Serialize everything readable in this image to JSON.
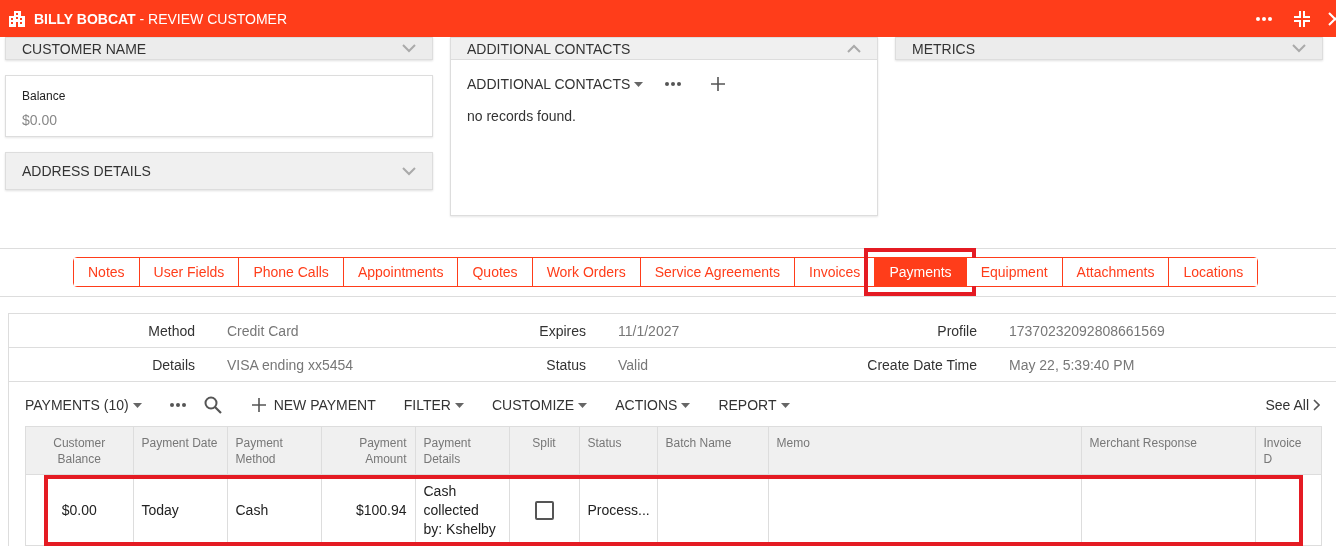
{
  "header": {
    "name": "BILLY BOBCAT",
    "title": "- REVIEW CUSTOMER"
  },
  "left_panels": [
    {
      "kind": "section",
      "title": "CUSTOMER NAME",
      "expanded": false
    },
    {
      "kind": "field",
      "label": "Balance",
      "value": "$0.00"
    },
    {
      "kind": "section",
      "title": "ADDRESS DETAILS",
      "expanded": false
    }
  ],
  "contacts": {
    "title": "ADDITIONAL CONTACTS",
    "expanded": true,
    "list_title": "ADDITIONAL CONTACTS",
    "empty_text": "no records found."
  },
  "metrics": {
    "title": "METRICS",
    "expanded": false
  },
  "tabs": [
    {
      "label": "Notes",
      "selected": false,
      "highlighted": false
    },
    {
      "label": "User Fields",
      "selected": false,
      "highlighted": false
    },
    {
      "label": "Phone Calls",
      "selected": false,
      "highlighted": false
    },
    {
      "label": "Appointments",
      "selected": false,
      "highlighted": false
    },
    {
      "label": "Quotes",
      "selected": false,
      "highlighted": false
    },
    {
      "label": "Work Orders",
      "selected": false,
      "highlighted": false
    },
    {
      "label": "Service Agreements",
      "selected": false,
      "highlighted": false
    },
    {
      "label": "Invoices",
      "selected": false,
      "highlighted": false
    },
    {
      "label": "Payments",
      "selected": true,
      "highlighted": true
    },
    {
      "label": "Equipment",
      "selected": false,
      "highlighted": false
    },
    {
      "label": "Attachments",
      "selected": false,
      "highlighted": false
    },
    {
      "label": "Locations",
      "selected": false,
      "highlighted": false
    }
  ],
  "details": [
    [
      {
        "label": "Method",
        "value": "Credit Card"
      },
      {
        "label": "Expires",
        "value": "11/1/2027"
      },
      {
        "label": "Profile",
        "value": "17370232092808661569"
      }
    ],
    [
      {
        "label": "Details",
        "value": "VISA ending xx5454"
      },
      {
        "label": "Status",
        "value": "Valid"
      },
      {
        "label": "Create Date Time",
        "value": "May 22, 5:39:40 PM"
      }
    ]
  ],
  "toolbar": [
    {
      "kind": "dropdown",
      "label": "PAYMENTS (10)"
    },
    {
      "kind": "more"
    },
    {
      "kind": "search"
    },
    {
      "kind": "add",
      "label": "NEW PAYMENT"
    },
    {
      "kind": "dropdown",
      "label": "FILTER"
    },
    {
      "kind": "dropdown",
      "label": "CUSTOMIZE"
    },
    {
      "kind": "dropdown",
      "label": "ACTIONS"
    },
    {
      "kind": "dropdown",
      "label": "REPORT"
    }
  ],
  "see_all": "See All",
  "table": {
    "columns": [
      {
        "label": "Customer Balance",
        "kind": "balance"
      },
      {
        "label": "Payment Date",
        "kind": "text"
      },
      {
        "label": "Payment Method",
        "kind": "text"
      },
      {
        "label": "Payment Amount",
        "kind": "amount"
      },
      {
        "label": "Payment Details",
        "kind": "text"
      },
      {
        "label": "Split",
        "kind": "check"
      },
      {
        "label": "Status",
        "kind": "text"
      },
      {
        "label": "Batch Name",
        "kind": "text"
      },
      {
        "label": "Memo",
        "kind": "text"
      },
      {
        "label": "Merchant Response",
        "kind": "text"
      },
      {
        "label": "Invoice D",
        "kind": "text"
      }
    ],
    "rows": [
      {
        "highlighted": true,
        "cells": [
          {
            "text": "$0.00"
          },
          {
            "text": "Today"
          },
          {
            "text": "Cash"
          },
          {
            "text": "$100.94"
          },
          {
            "text": "Cash collected by: Kshelby"
          },
          {
            "checked": false
          },
          {
            "text": "Process..."
          }
        ]
      }
    ]
  }
}
